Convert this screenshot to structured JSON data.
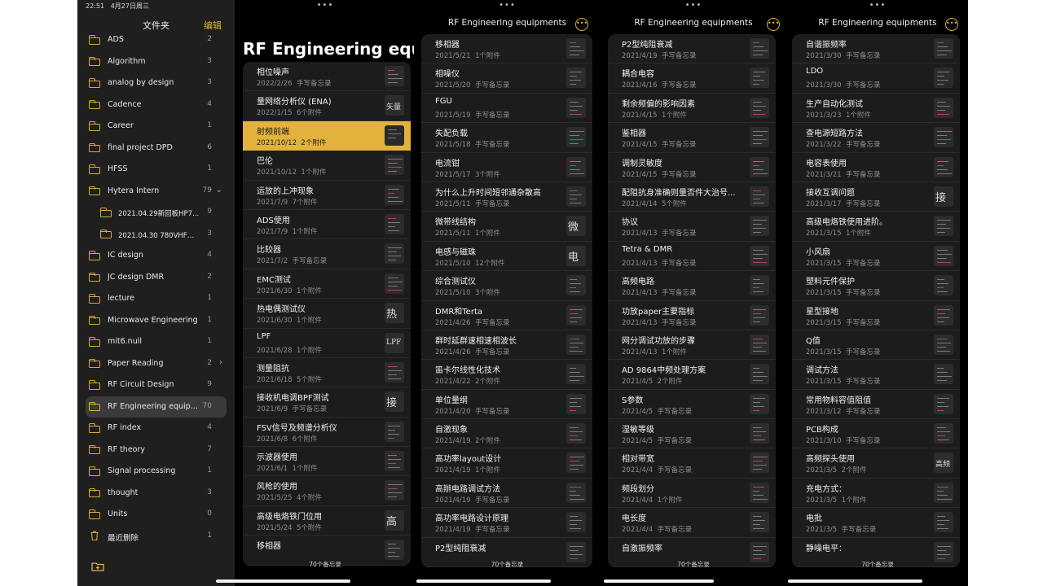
{
  "status": {
    "time": "22:51",
    "date": "4月27日周三"
  },
  "sidebar": {
    "title": "文件夹",
    "edit": "编辑",
    "folders": [
      {
        "label": "ADS",
        "count": "2"
      },
      {
        "label": "Algorithm",
        "count": "3"
      },
      {
        "label": "analog by design",
        "count": "3"
      },
      {
        "label": "Cadence",
        "count": "4"
      },
      {
        "label": "Career",
        "count": "1"
      },
      {
        "label": "final project DPD",
        "count": "6"
      },
      {
        "label": "HFSS",
        "count": "1"
      },
      {
        "label": "Hytera Intern",
        "count": "79",
        "chevron": "⌄"
      },
      {
        "label": "2021.04.29新回板HP7...",
        "count": "9",
        "sub": true
      },
      {
        "label": "2021.04.30 780VHF测...",
        "count": "3",
        "sub": true
      },
      {
        "label": "IC design",
        "count": "4"
      },
      {
        "label": "JC design DMR",
        "count": "2"
      },
      {
        "label": "lecture",
        "count": "1"
      },
      {
        "label": "Microwave Engineering",
        "count": "1"
      },
      {
        "label": "mit6.null",
        "count": "1"
      },
      {
        "label": "Paper Reading",
        "count": "2",
        "chevron": "›"
      },
      {
        "label": "RF Circuit Design",
        "count": "9"
      },
      {
        "label": "RF Engineering equipmen...",
        "count": "70",
        "active": true
      },
      {
        "label": "RF index",
        "count": "4"
      },
      {
        "label": "RF theory",
        "count": "7"
      },
      {
        "label": "Signal processing",
        "count": "1"
      },
      {
        "label": "thought",
        "count": "3"
      },
      {
        "label": "Units",
        "count": "0"
      },
      {
        "label": "最近删除",
        "count": "1",
        "trash": true
      }
    ]
  },
  "columns": [
    {
      "header": "",
      "big_title": "RF Engineering equipments",
      "footer": "70个备忘录",
      "notes": [
        {
          "title": "相位噪声",
          "date": "2022/2/26",
          "meta": "手写备忘录",
          "thumb": "lines"
        },
        {
          "title": "量网络分析仪 (ENA)",
          "date": "2022/1/15",
          "meta": "6个附件",
          "thumb": "hand",
          "hand": "矢量"
        },
        {
          "title": "射频前端",
          "date": "2021/10/12",
          "meta": "2个附件",
          "thumb": "dark",
          "selected": true
        },
        {
          "title": "巴伦",
          "date": "2021/10/12",
          "meta": "1个附件",
          "thumb": "lines"
        },
        {
          "title": "运放的上冲现象",
          "date": "2021/7/9",
          "meta": "7个附件",
          "thumb": "lines"
        },
        {
          "title": "ADS使用",
          "date": "2021/7/9",
          "meta": "1个附件",
          "thumb": "lines"
        },
        {
          "title": "比较器",
          "date": "2021/7/2",
          "meta": "手写备忘录",
          "thumb": "lines"
        },
        {
          "title": "EMC测试",
          "date": "2021/6/30",
          "meta": "1个附件",
          "thumb": "lines"
        },
        {
          "title": "热电偶测试仪",
          "date": "2021/6/30",
          "meta": "1个附件",
          "thumb": "hand",
          "hand": "热"
        },
        {
          "title": "LPF",
          "date": "2021/6/28",
          "meta": "1个附件",
          "thumb": "hand",
          "hand": "LPF"
        },
        {
          "title": "测量阻抗",
          "date": "2021/6/18",
          "meta": "5个附件",
          "thumb": "lines"
        },
        {
          "title": "接收机电调BPF测试",
          "date": "2021/6/9",
          "meta": "手写备忘录",
          "thumb": "hand",
          "hand": "接"
        },
        {
          "title": "FSV信号及频谱分析仪",
          "date": "2021/6/8",
          "meta": "6个附件",
          "thumb": "lines"
        },
        {
          "title": "示波器使用",
          "date": "2021/6/1",
          "meta": "1个附件",
          "thumb": "lines"
        },
        {
          "title": "风枪的使用",
          "date": "2021/5/25",
          "meta": "4个附件",
          "thumb": "lines"
        },
        {
          "title": "高级电烙铁门位用",
          "date": "2021/5/24",
          "meta": "5个附件",
          "thumb": "hand",
          "hand": "高"
        },
        {
          "title": "移相器",
          "date": "",
          "meta": "",
          "thumb": "lines"
        }
      ]
    },
    {
      "header": "RF Engineering equipments",
      "footer": "70个备忘录",
      "notes": [
        {
          "title": "移相器",
          "date": "2021/5/21",
          "meta": "1个附件",
          "thumb": "lines"
        },
        {
          "title": "相噪仪",
          "date": "2021/5/20",
          "meta": "手写备忘录",
          "thumb": "lines"
        },
        {
          "title": "FGU",
          "date": "2021/5/19",
          "meta": "手写备忘录",
          "thumb": "lines"
        },
        {
          "title": "失配负载",
          "date": "2021/5/18",
          "meta": "手写备忘录",
          "thumb": "lines"
        },
        {
          "title": "电流钳",
          "date": "2021/5/17",
          "meta": "3个附件",
          "thumb": "lines"
        },
        {
          "title": "为什么上升时间短邻通杂散高",
          "date": "2021/5/11",
          "meta": "手写备忘录",
          "thumb": "lines"
        },
        {
          "title": "微带线结构",
          "date": "2021/5/11",
          "meta": "1个附件",
          "thumb": "hand",
          "hand": "微"
        },
        {
          "title": "电感与磁珠",
          "date": "2021/5/10",
          "meta": "12个附件",
          "thumb": "hand",
          "hand": "电"
        },
        {
          "title": "综合测试仪",
          "date": "2021/5/10",
          "meta": "3个附件",
          "thumb": "lines"
        },
        {
          "title": "DMR和Terta",
          "date": "2021/4/26",
          "meta": "手写备忘录",
          "thumb": "lines"
        },
        {
          "title": "群时延群速相速相波长",
          "date": "2021/4/26",
          "meta": "手写备忘录",
          "thumb": "lines"
        },
        {
          "title": "笛卡尔线性化技术",
          "date": "2021/4/22",
          "meta": "2个附件",
          "thumb": "lines"
        },
        {
          "title": "单位量纲",
          "date": "2021/4/20",
          "meta": "手写备忘录",
          "thumb": "lines"
        },
        {
          "title": "自激现象",
          "date": "2021/4/19",
          "meta": "2个附件",
          "thumb": "lines"
        },
        {
          "title": "高功率layout设计",
          "date": "2021/4/19",
          "meta": "1个附件",
          "thumb": "lines"
        },
        {
          "title": "高辦电路调试方法",
          "date": "2021/4/19",
          "meta": "手写备忘录",
          "thumb": "lines"
        },
        {
          "title": "高功率电路设计原理",
          "date": "2021/4/19",
          "meta": "手写备忘录",
          "thumb": "lines"
        },
        {
          "title": "P2型纯阻衰减",
          "date": "",
          "meta": "",
          "thumb": "lines"
        }
      ]
    },
    {
      "header": "RF Engineering equipments",
      "footer": "70个备忘录",
      "notes": [
        {
          "title": "P2型纯阻衰减",
          "date": "2021/4/19",
          "meta": "手写备忘录",
          "thumb": "lines"
        },
        {
          "title": "耦合电容",
          "date": "2021/4/16",
          "meta": "手写备忘录",
          "thumb": "lines"
        },
        {
          "title": "剩余频偏的影响因素",
          "date": "2021/4/15",
          "meta": "1个附件",
          "thumb": "lines"
        },
        {
          "title": "鉴相器",
          "date": "2021/4/15",
          "meta": "手写备忘录",
          "thumb": "lines"
        },
        {
          "title": "调制灵敏度",
          "date": "2021/4/15",
          "meta": "手写备忘录",
          "thumb": "lines"
        },
        {
          "title": "配阻抗身准确则量否件大治号...",
          "date": "2021/4/14",
          "meta": "5个附件",
          "thumb": "lines"
        },
        {
          "title": "协议",
          "date": "2021/4/13",
          "meta": "手写备忘录",
          "thumb": "lines"
        },
        {
          "title": "Tetra & DMR",
          "date": "2021/4/13",
          "meta": "手写备忘录",
          "thumb": "lines"
        },
        {
          "title": "高频电路",
          "date": "2021/4/13",
          "meta": "手写备忘录",
          "thumb": "lines"
        },
        {
          "title": "功放paper主要指标",
          "date": "2021/4/13",
          "meta": "手写备忘录",
          "thumb": "lines"
        },
        {
          "title": "网分调试功放的步骤",
          "date": "2021/4/13",
          "meta": "1个附件",
          "thumb": "lines"
        },
        {
          "title": "AD 9864中频处理方案",
          "date": "2021/4/5",
          "meta": "2个附件",
          "thumb": "lines"
        },
        {
          "title": "S参数",
          "date": "2021/4/5",
          "meta": "手写备忘录",
          "thumb": "lines"
        },
        {
          "title": "湿敏等级",
          "date": "2021/4/5",
          "meta": "手写备忘录",
          "thumb": "lines"
        },
        {
          "title": "相对带宽",
          "date": "2021/4/4",
          "meta": "手写备忘录",
          "thumb": "lines"
        },
        {
          "title": "频段划分",
          "date": "2021/4/4",
          "meta": "1个附件",
          "thumb": "lines"
        },
        {
          "title": "电长度",
          "date": "2021/4/4",
          "meta": "手写备忘录",
          "thumb": "lines"
        },
        {
          "title": "自激振频率",
          "date": "",
          "meta": "",
          "thumb": "lines"
        }
      ]
    },
    {
      "header": "RF Engineering equipments",
      "footer": "70个备忘录",
      "notes": [
        {
          "title": "自谐振频率",
          "date": "2021/3/30",
          "meta": "手写备忘录",
          "thumb": "lines"
        },
        {
          "title": "LDO",
          "date": "2021/3/30",
          "meta": "手写备忘录",
          "thumb": "lines"
        },
        {
          "title": "生产自动化测试",
          "date": "2021/3/23",
          "meta": "1个附件",
          "thumb": "lines"
        },
        {
          "title": "查电源短路方法",
          "date": "2021/3/22",
          "meta": "手写备忘录",
          "thumb": "lines"
        },
        {
          "title": "电容表使用",
          "date": "2021/3/21",
          "meta": "手写备忘录",
          "thumb": "lines"
        },
        {
          "title": "接收互调问题",
          "date": "2021/3/17",
          "meta": "手写备忘录",
          "thumb": "hand",
          "hand": "接"
        },
        {
          "title": "高级电烙铁使用进阶。",
          "date": "2021/3/15",
          "meta": "1个附件",
          "thumb": "lines"
        },
        {
          "title": "小风扇",
          "date": "2021/3/15",
          "meta": "手写备忘录",
          "thumb": "lines"
        },
        {
          "title": "塑料元件保护",
          "date": "2021/3/15",
          "meta": "手写备忘录",
          "thumb": "lines"
        },
        {
          "title": "星型接地",
          "date": "2021/3/15",
          "meta": "手写备忘录",
          "thumb": "lines"
        },
        {
          "title": "Q值",
          "date": "2021/3/15",
          "meta": "手写备忘录",
          "thumb": "lines"
        },
        {
          "title": "调试方法",
          "date": "2021/3/15",
          "meta": "手写备忘录",
          "thumb": "lines"
        },
        {
          "title": "常用物料容值阻值",
          "date": "2021/3/12",
          "meta": "手写备忘录",
          "thumb": "lines"
        },
        {
          "title": "PCB构成",
          "date": "2021/3/10",
          "meta": "手写备忘录",
          "thumb": "lines"
        },
        {
          "title": "高频探头使用",
          "date": "2021/3/5",
          "meta": "2个附件",
          "thumb": "hand",
          "hand": "高频"
        },
        {
          "title": "充电方式：",
          "date": "2021/3/5",
          "meta": "1个附件",
          "thumb": "lines"
        },
        {
          "title": "电批",
          "date": "2021/3/5",
          "meta": "手写备忘录",
          "thumb": "lines"
        },
        {
          "title": "静噪电平：",
          "date": "",
          "meta": "",
          "thumb": "lines"
        }
      ]
    }
  ],
  "colors": {
    "accent": "#e1b338",
    "selected": "#e3b23c",
    "sidebar_bg": "#1f1f1f",
    "list_bg": "#1c1c1e"
  }
}
